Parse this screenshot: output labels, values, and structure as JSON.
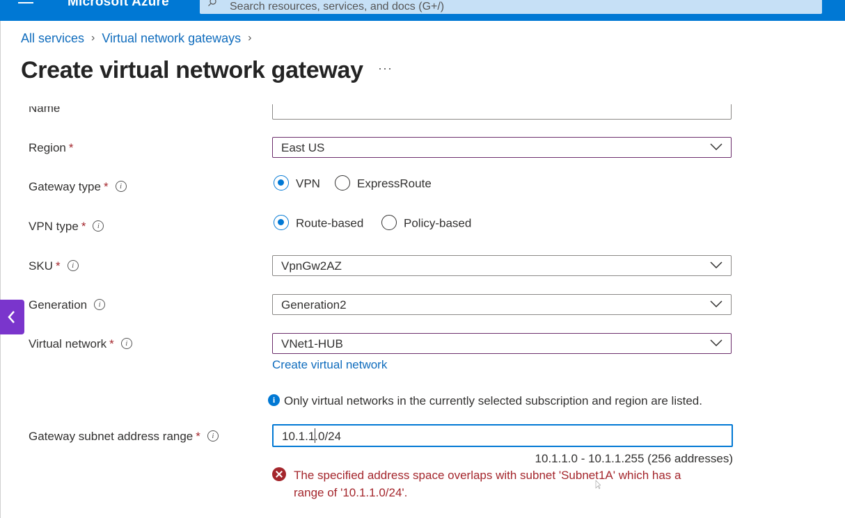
{
  "topbar": {
    "brand": "Microsoft Azure",
    "search_placeholder": "Search resources, services, and docs (G+/)"
  },
  "breadcrumb": {
    "items": [
      "All services",
      "Virtual network gateways"
    ]
  },
  "page": {
    "title": "Create virtual network gateway",
    "more": "···"
  },
  "form": {
    "name_label": "Name",
    "region": {
      "label": "Region",
      "required": "*",
      "value": "East US"
    },
    "gateway_type": {
      "label": "Gateway type",
      "required": "*",
      "options": [
        "VPN",
        "ExpressRoute"
      ],
      "selected": "VPN"
    },
    "vpn_type": {
      "label": "VPN type",
      "required": "*",
      "options": [
        "Route-based",
        "Policy-based"
      ],
      "selected": "Route-based"
    },
    "sku": {
      "label": "SKU",
      "required": "*",
      "value": "VpnGw2AZ"
    },
    "generation": {
      "label": "Generation",
      "value": "Generation2"
    },
    "virtual_network": {
      "label": "Virtual network",
      "required": "*",
      "value": "VNet1-HUB",
      "create_link": "Create virtual network"
    },
    "info_note": "Only virtual networks in the currently selected subscription and region are listed.",
    "gateway_subnet": {
      "label": "Gateway subnet address range",
      "required": "*",
      "value": "10.1.1.0/24",
      "range_hint": "10.1.1.0 - 10.1.1.255 (256 addresses)",
      "error": "The specified address space overlaps with subnet 'Subnet1A' which has a range of '10.1.1.0/24'."
    }
  },
  "colors": {
    "accent": "#0078d4",
    "error": "#a4262c",
    "collapse_tab": "#7a35cc"
  }
}
